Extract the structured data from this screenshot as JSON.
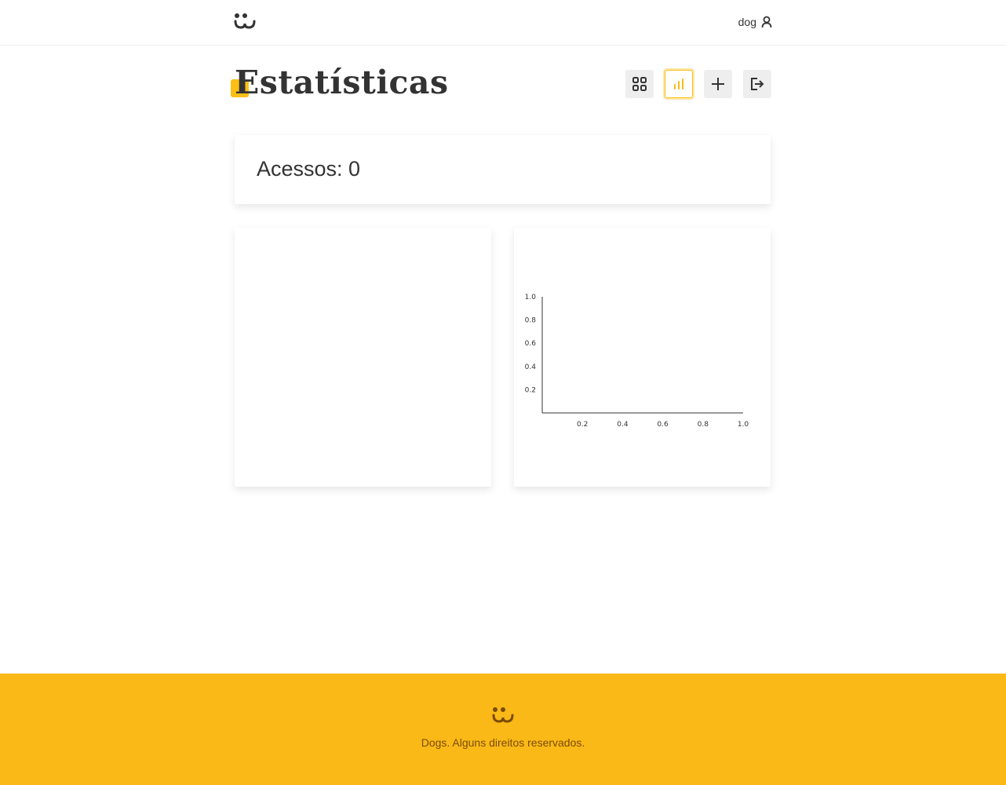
{
  "header": {
    "logo_icon": "dog-face-icon",
    "user_label": "dog",
    "user_icon": "user-icon"
  },
  "page": {
    "title": "Estatísticas"
  },
  "nav": {
    "buttons": [
      {
        "name": "my-photos",
        "icon": "grid-icon",
        "active": false
      },
      {
        "name": "statistics",
        "icon": "bar-chart-icon",
        "active": true
      },
      {
        "name": "add-photo",
        "icon": "plus-icon",
        "active": false
      },
      {
        "name": "logout",
        "icon": "logout-icon",
        "active": false
      }
    ]
  },
  "stats": {
    "access_text": "Acessos: 0"
  },
  "chart_data": {
    "type": "bar",
    "title": "",
    "xlabel": "",
    "ylabel": "",
    "xlim": [
      0,
      1.0
    ],
    "ylim": [
      0,
      1.0
    ],
    "xticks": [
      "0.2",
      "0.4",
      "0.6",
      "0.8",
      "1.0"
    ],
    "yticks": [
      "0.2",
      "0.4",
      "0.6",
      "0.8",
      "1.0"
    ],
    "categories": [],
    "values": []
  },
  "footer": {
    "logo_icon": "dog-face-icon",
    "text": "Dogs. Alguns direitos reservados."
  },
  "colors": {
    "accent": "#fbb917",
    "text": "#333333",
    "footer_text": "#7a4c08",
    "button_bg": "#eeeeee"
  }
}
